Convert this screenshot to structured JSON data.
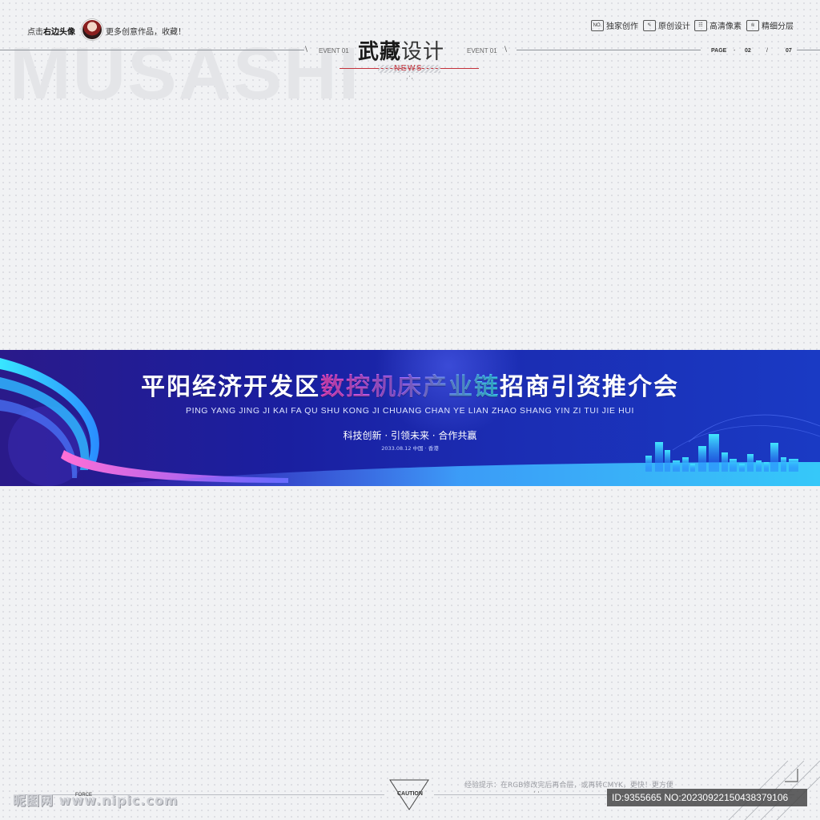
{
  "header": {
    "watermark_big": "MUSASHI",
    "prompt_prefix": "点击",
    "prompt_bold": "右边头像",
    "prompt_suffix": "更多创意作品，收藏！",
    "event_left": "EVENT 01",
    "event_right": "EVENT 01",
    "brand_bold": "武藏",
    "brand_thin": "设计",
    "news": "NEWS",
    "badges": [
      {
        "icon": "NO.",
        "label": "独家创作"
      },
      {
        "icon": "✎",
        "label": "原创设计"
      },
      {
        "icon": "☷",
        "label": "高清像素"
      },
      {
        "icon": "≋",
        "label": "精细分层"
      }
    ],
    "page_label": "PAGE",
    "page_current": "02",
    "page_sep": "/",
    "page_total": "07"
  },
  "banner": {
    "title_part1": "平阳经济开发区",
    "title_highlight": "数控机床产业链",
    "title_part2": "招商引资推介会",
    "pinyin": "PING YANG JING JI KAI FA QU SHU KONG JI CHUANG CHAN YE LIAN ZHAO SHANG YIN ZI TUI JIE HUI",
    "slogan": "科技创新 · 引领未来 · 合作共赢",
    "date_location": "2033.08.12 中国 · 香港",
    "colors": {
      "bg_start": "#2a1a8a",
      "bg_end": "#1a3ac4",
      "accent_cyan": "#3fe0ff",
      "accent_pink": "#ff4fd8"
    }
  },
  "footer": {
    "caution": "CAUTION",
    "tip": "经验提示：在RGB修改完后再合层，或再转CMYK，更快！更方便",
    "logo_text": "昵图网 www.nipic.com",
    "small_text": "FORCE",
    "id_text": "ID:9355665 NO:20230922150438379106"
  }
}
